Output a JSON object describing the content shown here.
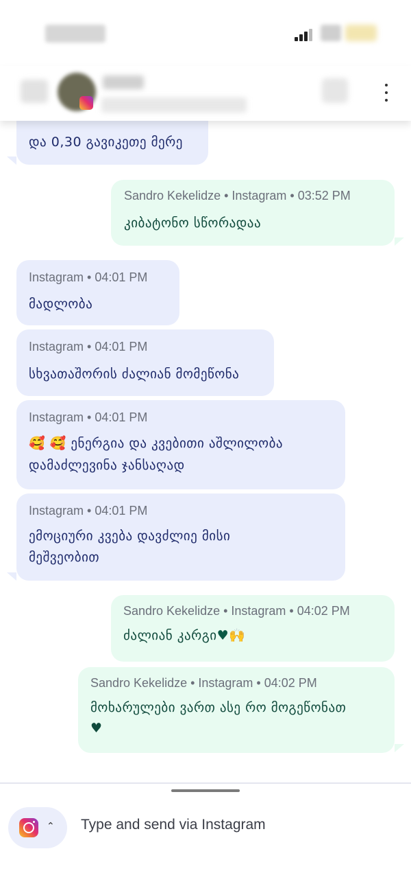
{
  "input": {
    "placeholder": "Type and send via Instagram"
  },
  "messages": [
    {
      "direction": "incoming",
      "meta": "",
      "text": "და 0,30 გავიკეთე მერე"
    },
    {
      "direction": "outgoing",
      "meta": "Sandro Kekelidze • Instagram • 03:52 PM",
      "text": "კიბატონო სწორადაა"
    },
    {
      "direction": "incoming",
      "meta": "Instagram • 04:01 PM",
      "text": "მადლობა"
    },
    {
      "direction": "incoming",
      "meta": "Instagram • 04:01 PM",
      "text": "სხვათაშორის ძალიან მომეწონა"
    },
    {
      "direction": "incoming",
      "meta": "Instagram • 04:01 PM",
      "text_emoji": "🥰 🥰",
      "text_line1": "ენერგია და კვებითი აშლილობა",
      "text_line2": "დამაძლევინა ჯანსაღად"
    },
    {
      "direction": "incoming",
      "meta": "Instagram • 04:01 PM",
      "text_line1": "ემოციური კვება დავძლიე მისი",
      "text_line2": "მეშვეობით"
    },
    {
      "direction": "outgoing",
      "meta": "Sandro Kekelidze • Instagram • 04:02 PM",
      "text": "ძალიან კარგი",
      "emoji": "♥🙌"
    },
    {
      "direction": "outgoing",
      "meta": "Sandro Kekelidze • Instagram • 04:02 PM",
      "text_line1": "მოხარულები ვართ ასე რო მოგეწონათ",
      "emoji": "♥"
    }
  ],
  "icons": {
    "menu": "more-vert-icon",
    "channel": "instagram-icon",
    "expand": "chevron-up-icon"
  },
  "colors": {
    "incoming_bubble": "#e9edfc",
    "outgoing_bubble": "#e8fbf1",
    "incoming_text": "#1f2b6b",
    "outgoing_text": "#104a3c"
  }
}
